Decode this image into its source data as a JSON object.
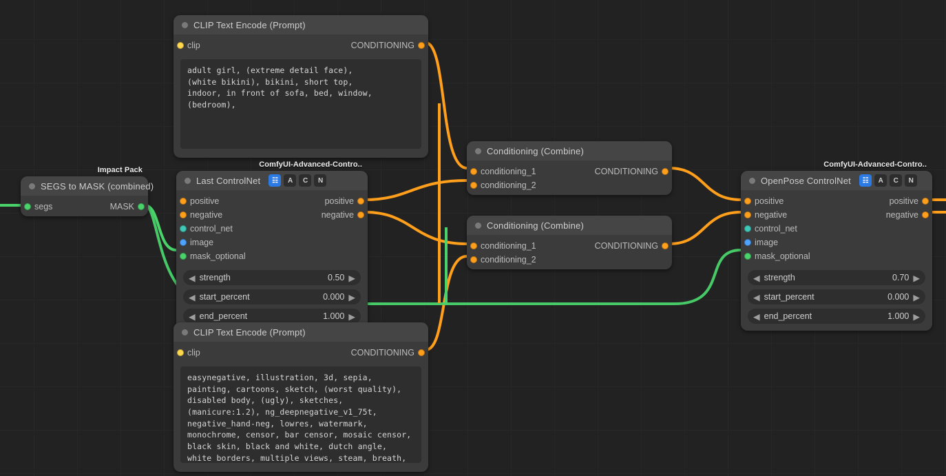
{
  "tags": {
    "impact": "Impact Pack",
    "acn": "ComfyUI-Advanced-Contro.."
  },
  "nodes": {
    "segs": {
      "title": "SEGS to MASK (combined)",
      "in": {
        "segs": "segs"
      },
      "out": {
        "mask": "MASK"
      }
    },
    "clipPos": {
      "title": "CLIP Text Encode (Prompt)",
      "in": {
        "clip": "clip"
      },
      "out": {
        "cond": "CONDITIONING"
      },
      "text": "adult girl, (extreme detail face),\n(white bikini), bikini, short top,\nindoor, in front of sofa, bed, window, (bedroom),"
    },
    "clipNeg": {
      "title": "CLIP Text Encode (Prompt)",
      "in": {
        "clip": "clip"
      },
      "out": {
        "cond": "CONDITIONING"
      },
      "text": "easynegative, illustration, 3d, sepia, painting, cartoons, sketch, (worst quality), disabled body, (ugly), sketches, (manicure:1.2), ng_deepnegative_v1_75t, negative_hand-neg, lowres, watermark, monochrome, censor, bar censor, mosaic censor, black skin, black and white, dutch angle, white borders, multiple views, steam, breath, steaming body, deformed, disfigured, bad anatomy, extra limb, floating limbs, disconnected limbs, blurry, tattoo, text, missing fingers, fewer digits, signature, username, censorship, old, amateur drawing, bad hands,"
    },
    "lastCN": {
      "title": "Last ControlNet",
      "in": {
        "positive": "positive",
        "negative": "negative",
        "control_net": "control_net",
        "image": "image",
        "mask_optional": "mask_optional"
      },
      "out": {
        "positive": "positive",
        "negative": "negative"
      },
      "params": {
        "strength": {
          "name": "strength",
          "value": "0.50"
        },
        "start": {
          "name": "start_percent",
          "value": "0.000"
        },
        "end": {
          "name": "end_percent",
          "value": "1.000"
        }
      }
    },
    "openCN": {
      "title": "OpenPose ControlNet",
      "in": {
        "positive": "positive",
        "negative": "negative",
        "control_net": "control_net",
        "image": "image",
        "mask_optional": "mask_optional"
      },
      "out": {
        "positive": "positive",
        "negative": "negative"
      },
      "params": {
        "strength": {
          "name": "strength",
          "value": "0.70"
        },
        "start": {
          "name": "start_percent",
          "value": "0.000"
        },
        "end": {
          "name": "end_percent",
          "value": "1.000"
        }
      }
    },
    "comb1": {
      "title": "Conditioning (Combine)",
      "in": {
        "c1": "conditioning_1",
        "c2": "conditioning_2"
      },
      "out": {
        "cond": "CONDITIONING"
      }
    },
    "comb2": {
      "title": "Conditioning (Combine)",
      "in": {
        "c1": "conditioning_1",
        "c2": "conditioning_2"
      },
      "out": {
        "cond": "CONDITIONING"
      }
    }
  }
}
